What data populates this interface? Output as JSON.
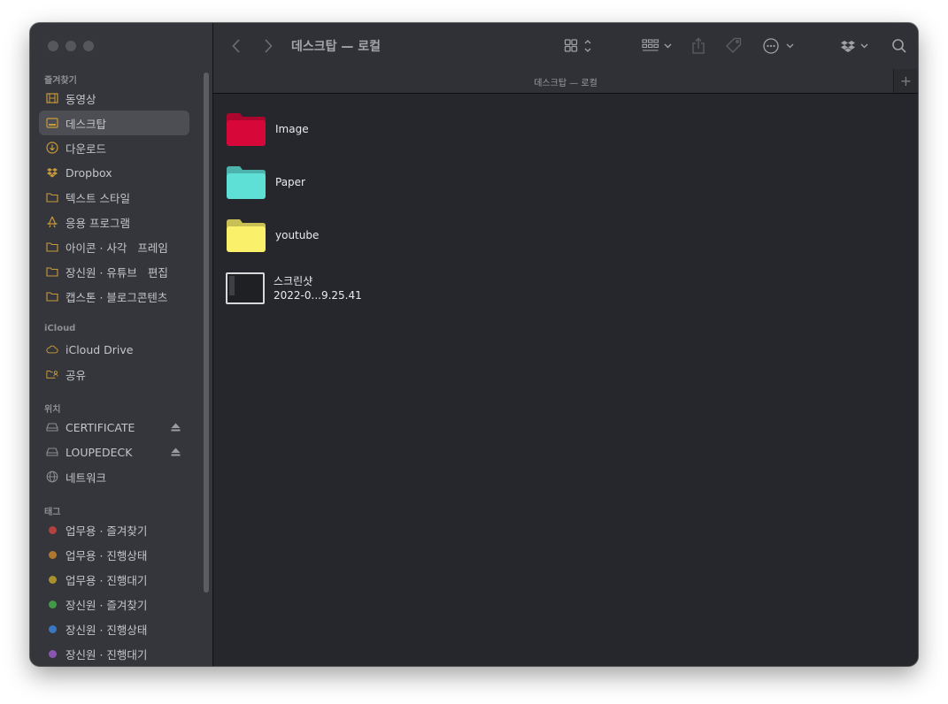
{
  "window": {
    "title": "데스크탑 — 로컬"
  },
  "pathbar": {
    "label": "데스크탑 — 로컬",
    "add_label": "+"
  },
  "sidebar": {
    "favorites_header": "즐겨찾기",
    "favorites": [
      {
        "label": "동영상",
        "icon": "film-icon"
      },
      {
        "label": "데스크탑",
        "icon": "desktop-icon",
        "selected": true
      },
      {
        "label": "다운로드",
        "icon": "download-icon"
      },
      {
        "label": "Dropbox",
        "icon": "dropbox-icon"
      },
      {
        "label": "텍스트 스타일",
        "icon": "folder-icon"
      },
      {
        "label": "응용 프로그램",
        "icon": "applications-icon"
      },
      {
        "label": "아이콘 · 사각   프레임",
        "icon": "folder-icon"
      },
      {
        "label": "장신원 · 유튜브   편집",
        "icon": "folder-icon"
      },
      {
        "label": "캡스톤 · 블로그콘텐츠",
        "icon": "folder-icon"
      }
    ],
    "icloud_header": "iCloud",
    "icloud": [
      {
        "label": "iCloud Drive",
        "icon": "cloud-icon"
      },
      {
        "label": "공유",
        "icon": "shared-folder-icon"
      }
    ],
    "locations_header": "위치",
    "locations": [
      {
        "label": "CERTIFICATE",
        "icon": "drive-icon",
        "eject": true
      },
      {
        "label": "LOUPEDECK",
        "icon": "drive-icon",
        "eject": true
      },
      {
        "label": "네트워크",
        "icon": "network-icon"
      }
    ],
    "tags_header": "태그",
    "tags": [
      {
        "label": "업무용 · 즐겨찾기",
        "color": "#b5413f"
      },
      {
        "label": "업무용 · 진행상태",
        "color": "#b0782e"
      },
      {
        "label": "업무용 · 진행대기",
        "color": "#a8912c"
      },
      {
        "label": "장신원 · 즐겨찾기",
        "color": "#3f9b45"
      },
      {
        "label": "장신원 · 진행상태",
        "color": "#3a77c0"
      },
      {
        "label": "장신원 · 진행대기",
        "color": "#8a55b3"
      }
    ]
  },
  "files": [
    {
      "name": "Image",
      "kind": "folder",
      "color": "#d8073a"
    },
    {
      "name": "Paper",
      "kind": "folder",
      "color": "#5ee0d6"
    },
    {
      "name": "youtube",
      "kind": "folder",
      "color": "#fbf06a"
    },
    {
      "name": "스크린샷",
      "name2": "2022-0...9.25.41",
      "kind": "screenshot"
    }
  ]
}
